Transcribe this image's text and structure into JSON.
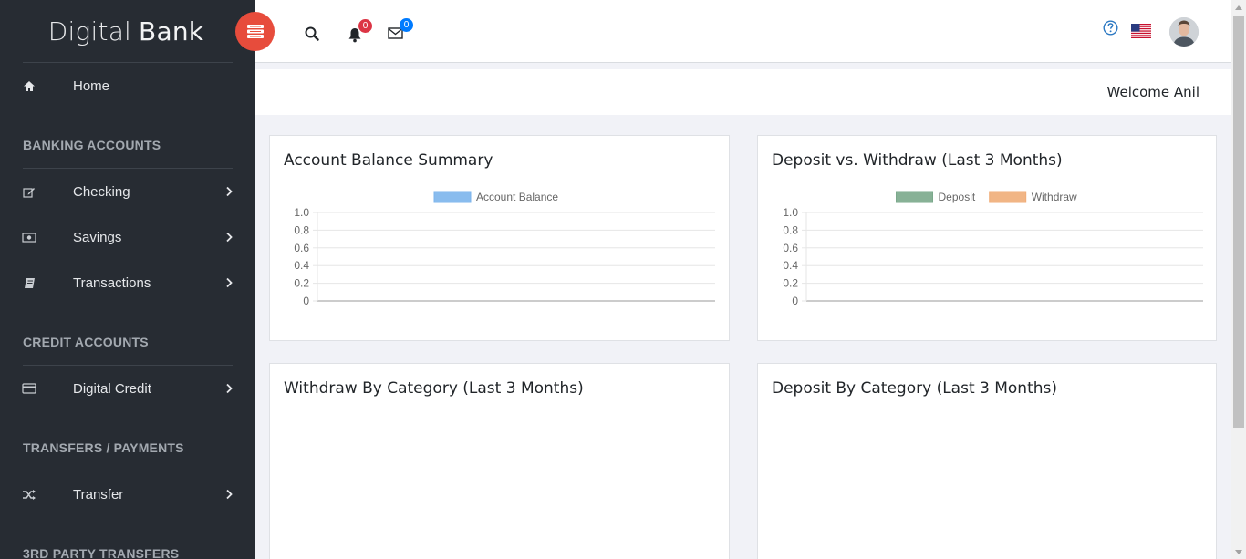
{
  "brand": {
    "light": "Digital",
    "bold": "Bank"
  },
  "sidebar": {
    "home": "Home",
    "sections": [
      {
        "title": "BANKING ACCOUNTS",
        "items": [
          "Checking",
          "Savings",
          "Transactions"
        ]
      },
      {
        "title": "CREDIT ACCOUNTS",
        "items": [
          "Digital Credit"
        ]
      },
      {
        "title": "TRANSFERS / PAYMENTS",
        "items": [
          "Transfer"
        ]
      },
      {
        "title": "3RD PARTY TRANSFERS",
        "items": []
      }
    ],
    "icons": {
      "home": "home-icon",
      "checking": "edit-icon",
      "savings": "money-icon",
      "transactions": "book-icon",
      "digital_credit": "credit-card-icon",
      "transfer": "shuffle-icon"
    }
  },
  "header": {
    "notifications_count": "0",
    "messages_count": "0",
    "icons": [
      "menu-icon",
      "search-icon",
      "bell-icon",
      "envelope-icon",
      "help-icon",
      "us-flag-icon",
      "avatar"
    ]
  },
  "welcome": "Welcome Anil",
  "colors": {
    "sidebar_bg": "#272c33",
    "toggle": "#e74c3c",
    "account_balance": "#7cb5ec",
    "deposit": "#7aa88b",
    "withdraw": "#f0ad78",
    "badge_red": "#dc3545",
    "badge_blue": "#007bff"
  },
  "cards": {
    "balance_title": "Account Balance Summary",
    "deposit_withdraw_title": "Deposit vs. Withdraw (Last 3 Months)",
    "withdraw_category_title": "Withdraw By Category (Last 3 Months)",
    "deposit_category_title": "Deposit By Category (Last 3 Months)"
  },
  "chart_data": [
    {
      "type": "bar",
      "categories": [],
      "series": [
        {
          "name": "Account Balance",
          "values": []
        }
      ],
      "yticks": [
        "1.0",
        "0.8",
        "0.6",
        "0.4",
        "0.2",
        "0"
      ],
      "ylim": [
        0,
        1
      ],
      "legend": "top"
    },
    {
      "type": "bar",
      "categories": [],
      "series": [
        {
          "name": "Deposit",
          "values": []
        },
        {
          "name": "Withdraw",
          "values": []
        }
      ],
      "yticks": [
        "1.0",
        "0.8",
        "0.6",
        "0.4",
        "0.2",
        "0"
      ],
      "ylim": [
        0,
        1
      ],
      "legend": "top"
    }
  ]
}
